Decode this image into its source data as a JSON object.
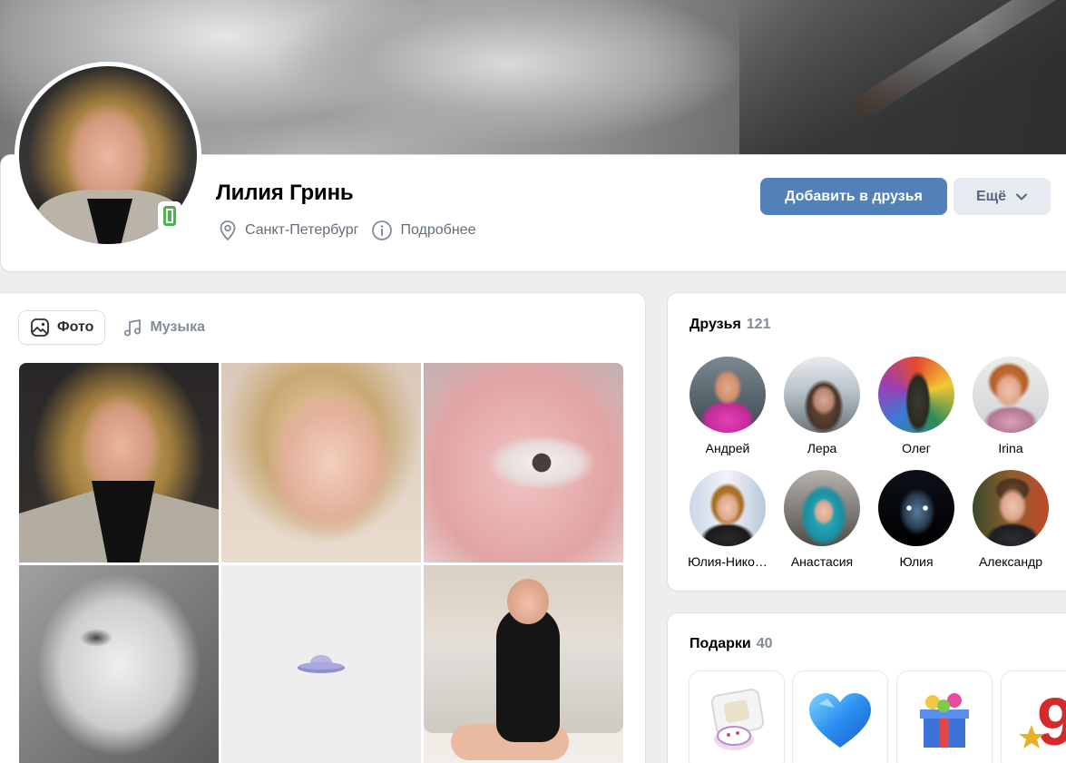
{
  "profile": {
    "name": "Лилия Гринь",
    "city": "Санкт-Петербург",
    "details_label": "Подробнее",
    "add_friend_label": "Добавить в друзья",
    "more_label": "Ещё"
  },
  "tabs": [
    {
      "label": "Фото",
      "icon": "photo-icon",
      "active": true
    },
    {
      "label": "Музыка",
      "icon": "music-icon",
      "active": false
    }
  ],
  "friends": {
    "title": "Друзья",
    "count": "121",
    "items": [
      {
        "name": "Андрей"
      },
      {
        "name": "Лера"
      },
      {
        "name": "Олег"
      },
      {
        "name": "Irina"
      },
      {
        "name": "Юлия-Нико…"
      },
      {
        "name": "Анастасия"
      },
      {
        "name": "Юлия"
      },
      {
        "name": "Александр"
      }
    ]
  },
  "gifts": {
    "title": "Подарки",
    "count": "40"
  },
  "colors": {
    "accent": "#5181b8",
    "secondary_button": "#e5ebf1",
    "online": "#4bb34b",
    "page_bg": "#edeef0"
  }
}
